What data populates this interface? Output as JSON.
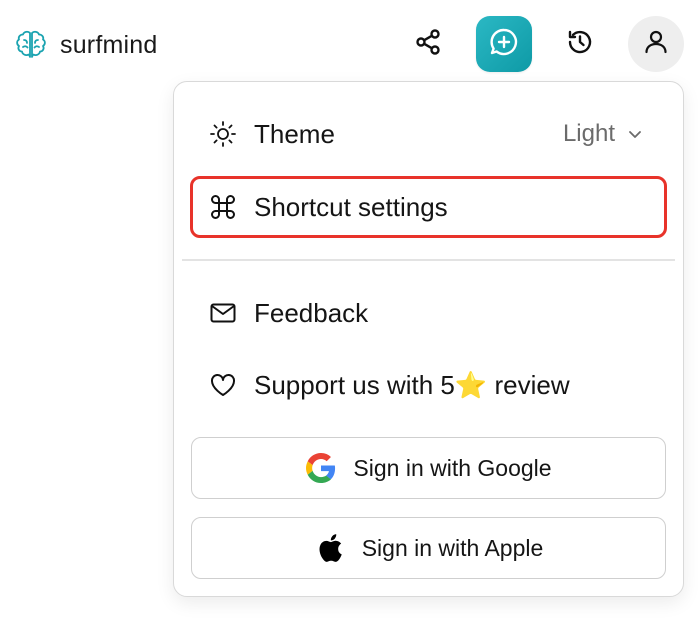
{
  "header": {
    "brand_name": "surfmind",
    "buttons": {
      "share": "share-icon",
      "new_chat": "new-chat-icon",
      "history": "history-icon",
      "account": "user-icon"
    },
    "accent_color": "#17A9B4"
  },
  "menu": {
    "theme": {
      "label": "Theme",
      "value": "Light"
    },
    "shortcut": {
      "label": "Shortcut settings",
      "highlight_color": "#E8332A"
    },
    "feedback": {
      "label": "Feedback"
    },
    "support": {
      "label": "Support us with 5⭐️ review"
    },
    "google_signin": {
      "label": "Sign in with Google"
    },
    "apple_signin": {
      "label": "Sign in with Apple"
    }
  }
}
